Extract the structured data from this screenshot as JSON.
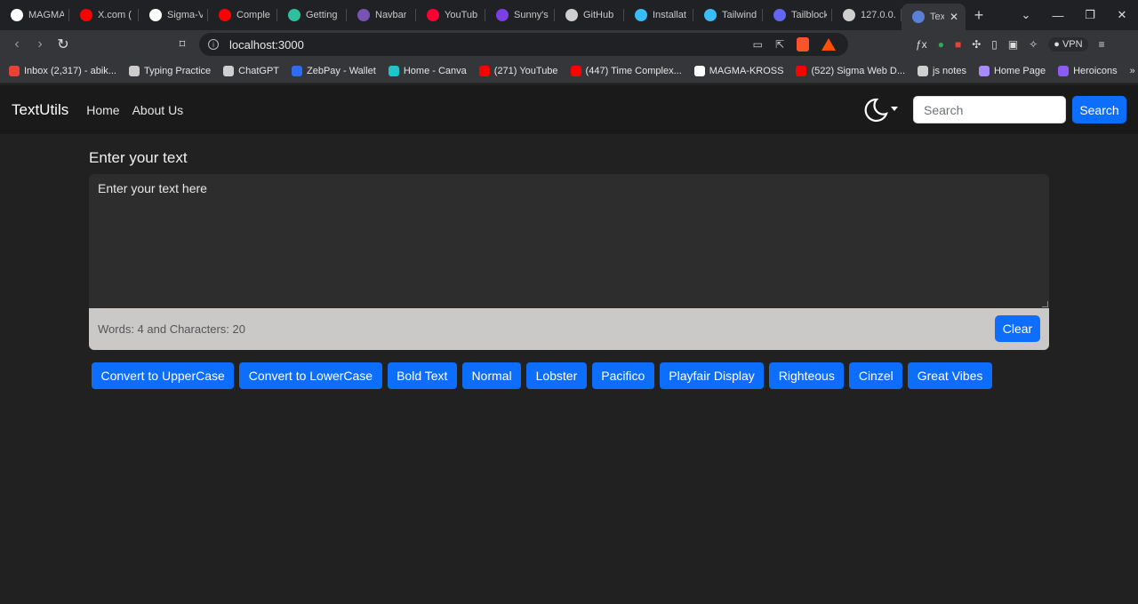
{
  "browser": {
    "tabs": [
      {
        "label": "MAGMA",
        "icon": "github-icon",
        "color": "#ffffff"
      },
      {
        "label": "X.com (",
        "icon": "youtube-icon",
        "color": "#ff0000"
      },
      {
        "label": "Sigma-V",
        "icon": "github-icon",
        "color": "#ffffff"
      },
      {
        "label": "Comple",
        "icon": "youtube-icon",
        "color": "#ff0000"
      },
      {
        "label": "Getting",
        "icon": "react-icon",
        "color": "#2fbf9f"
      },
      {
        "label": "Navbar",
        "icon": "bootstrap-icon",
        "color": "#7952b3"
      },
      {
        "label": "YouTub",
        "icon": "youtube-music-icon",
        "color": "#ff0033"
      },
      {
        "label": "Sunny's",
        "icon": "planet-icon",
        "color": "#7b3fe4"
      },
      {
        "label": "GitHub",
        "icon": "openai-icon",
        "color": "#cfcfcf"
      },
      {
        "label": "Installat",
        "icon": "tailwind-icon",
        "color": "#38bdf8"
      },
      {
        "label": "Tailwind",
        "icon": "tailwind-icon",
        "color": "#38bdf8"
      },
      {
        "label": "Tailblock",
        "icon": "tailblocks-icon",
        "color": "#6366f1"
      },
      {
        "label": "127.0.0.",
        "icon": "globe-icon",
        "color": "#cfcfcf"
      }
    ],
    "active_tab": {
      "label": "Text",
      "icon": "textutils-icon"
    },
    "address": "localhost:3000",
    "vpn_label": "VPN",
    "bookmarks": [
      {
        "label": "Inbox (2,317) - abik...",
        "icon": "gmail-icon",
        "color": "#ea4335"
      },
      {
        "label": "Typing Practice",
        "icon": "keyboard-icon",
        "color": "#cccccc"
      },
      {
        "label": "ChatGPT",
        "icon": "openai-icon",
        "color": "#cfcfcf"
      },
      {
        "label": "ZebPay - Wallet",
        "icon": "zebpay-icon",
        "color": "#2f6cf6"
      },
      {
        "label": "Home - Canva",
        "icon": "canva-icon",
        "color": "#20c4cb"
      },
      {
        "label": "(271) YouTube",
        "icon": "youtube-icon",
        "color": "#ff0000"
      },
      {
        "label": "(447) Time Complex...",
        "icon": "youtube-icon",
        "color": "#ff0000"
      },
      {
        "label": "MAGMA-KROSS",
        "icon": "github-icon",
        "color": "#ffffff"
      },
      {
        "label": "(522) Sigma Web D...",
        "icon": "youtube-icon",
        "color": "#ff0000"
      },
      {
        "label": "js notes",
        "icon": "globe-icon",
        "color": "#cfcfcf"
      },
      {
        "label": "Home Page",
        "icon": "cloud-icon",
        "color": "#a78bfa"
      },
      {
        "label": "Heroicons",
        "icon": "shield-icon",
        "color": "#8b5cf6"
      }
    ]
  },
  "app": {
    "brand": "TextUtils",
    "nav": [
      "Home",
      "About Us"
    ],
    "search_placeholder": "Search",
    "search_button": "Search",
    "heading": "Enter your text",
    "textarea_value": "Enter your text here",
    "summary": "Words: 4 and Characters: 20",
    "clear_button": "Clear",
    "buttons": [
      "Convert to UpperCase",
      "Convert to LowerCase",
      "Bold Text",
      "Normal",
      "Lobster",
      "Pacifico",
      "Playfair Display",
      "Righteous",
      "Cinzel",
      "Great Vibes"
    ],
    "accent": "#0d6efd"
  }
}
